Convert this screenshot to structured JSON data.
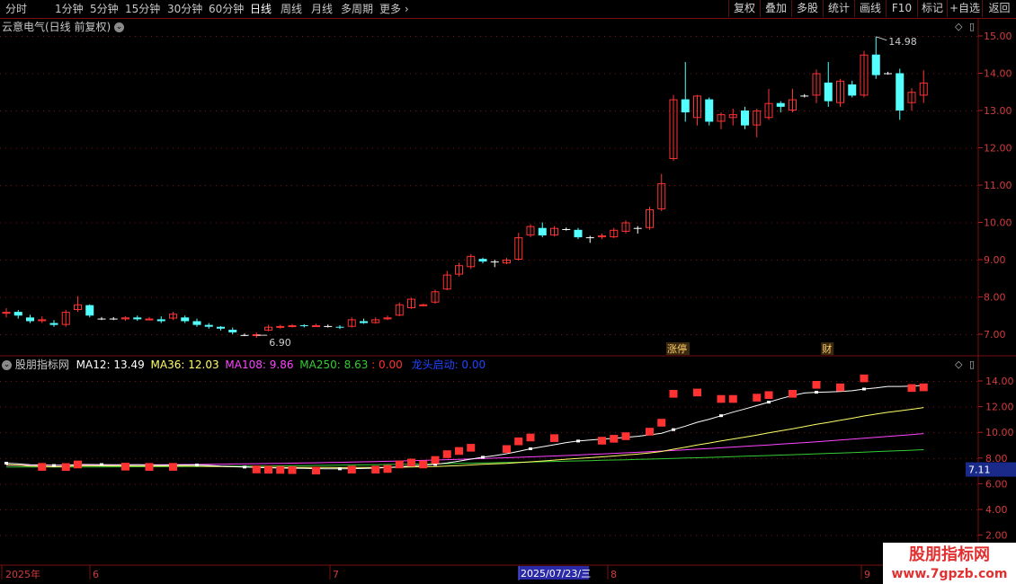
{
  "toolbar": {
    "periods": [
      "分时",
      "1分钟",
      "5分钟",
      "15分钟",
      "30分钟",
      "60分钟",
      "日线",
      "周线",
      "月线",
      "多周期",
      "更多"
    ],
    "active": "日线",
    "right_buttons": [
      "复权",
      "叠加",
      "多股",
      "统计",
      "画线",
      "F10",
      "标记",
      "+自选",
      "返回"
    ]
  },
  "main_header": {
    "title": "云意电气(日线 前复权)"
  },
  "price_axis": {
    "labels": [
      "15.00",
      "14.00",
      "13.00",
      "12.00",
      "11.00",
      "10.00",
      "9.00",
      "8.00",
      "7.00"
    ]
  },
  "high_label": "14.98",
  "low_label": "6.90",
  "event_tags": [
    "涨停",
    "财"
  ],
  "indicator_header": {
    "name": "股朋指标网",
    "ma12": "MA12: 13.49",
    "ma36": "MA36: 12.03",
    "ma108": "MA108: 9.86",
    "ma250": "MA250: 8.63",
    "val": ": 0.00",
    "longstart": "龙头启动: 0.00"
  },
  "indicator_axis": {
    "labels": [
      "14.00",
      "12.00",
      "10.00",
      "8.00",
      "6.00",
      "4.00",
      "2.00"
    ],
    "marker": "7.11"
  },
  "date_axis": {
    "labels": [
      "2025年",
      "6",
      "7",
      "8",
      "9"
    ],
    "cursor": "2025/07/23/三"
  },
  "watermark": {
    "line1": "股朋指标网",
    "line2": "www.7gpzb.com"
  },
  "colors": {
    "up": "#ff3232",
    "down": "#54ffff",
    "ma12": "#ffffff",
    "ma36": "#ffff66",
    "ma108": "#ff44ff",
    "ma250": "#33cc33",
    "grid": "#7a1010"
  },
  "chart_data": {
    "type": "candlestick",
    "y_range": [
      6.5,
      15.3
    ],
    "candles": [
      [
        7.55,
        7.6,
        7.7,
        7.45
      ],
      [
        7.6,
        7.5,
        7.65,
        7.42
      ],
      [
        7.45,
        7.35,
        7.52,
        7.3
      ],
      [
        7.35,
        7.4,
        7.48,
        7.3
      ],
      [
        7.3,
        7.25,
        7.38,
        7.2
      ],
      [
        7.25,
        7.6,
        7.65,
        7.2
      ],
      [
        7.65,
        7.8,
        8.02,
        7.6
      ],
      [
        7.78,
        7.5,
        7.8,
        7.45
      ],
      [
        7.42,
        7.42,
        7.46,
        7.38
      ],
      [
        7.42,
        7.42,
        7.46,
        7.38
      ],
      [
        7.4,
        7.45,
        7.48,
        7.36
      ],
      [
        7.45,
        7.4,
        7.5,
        7.36
      ],
      [
        7.4,
        7.42,
        7.46,
        7.38
      ],
      [
        7.4,
        7.35,
        7.48,
        7.3
      ],
      [
        7.42,
        7.55,
        7.6,
        7.38
      ],
      [
        7.45,
        7.35,
        7.5,
        7.3
      ],
      [
        7.35,
        7.25,
        7.42,
        7.2
      ],
      [
        7.25,
        7.2,
        7.3,
        7.15
      ],
      [
        7.2,
        7.15,
        7.22,
        7.1
      ],
      [
        7.12,
        7.05,
        7.18,
        7.0
      ],
      [
        6.98,
        6.98,
        7.02,
        6.95
      ],
      [
        6.98,
        7.0,
        7.05,
        6.9
      ],
      [
        7.1,
        7.2,
        7.25,
        7.08
      ],
      [
        7.18,
        7.22,
        7.25,
        7.15
      ],
      [
        7.2,
        7.24,
        7.27,
        7.18
      ],
      [
        7.24,
        7.22,
        7.27,
        7.18
      ],
      [
        7.22,
        7.24,
        7.28,
        7.2
      ],
      [
        7.22,
        7.22,
        7.26,
        7.18
      ],
      [
        7.2,
        7.18,
        7.24,
        7.14
      ],
      [
        7.2,
        7.4,
        7.45,
        7.18
      ],
      [
        7.35,
        7.3,
        7.42,
        7.28
      ],
      [
        7.3,
        7.4,
        7.45,
        7.28
      ],
      [
        7.4,
        7.45,
        7.5,
        7.38
      ],
      [
        7.5,
        7.8,
        7.85,
        7.48
      ],
      [
        7.7,
        7.95,
        7.98,
        7.68
      ],
      [
        7.78,
        7.8,
        7.82,
        7.75
      ],
      [
        7.85,
        8.15,
        8.2,
        7.82
      ],
      [
        8.2,
        8.6,
        8.7,
        8.18
      ],
      [
        8.6,
        8.85,
        8.92,
        8.55
      ],
      [
        8.8,
        9.1,
        9.15,
        8.75
      ],
      [
        9.02,
        8.95,
        9.05,
        8.9
      ],
      [
        8.95,
        8.95,
        9.0,
        8.8
      ],
      [
        8.9,
        9.0,
        9.05,
        8.88
      ],
      [
        9.0,
        9.6,
        9.72,
        8.98
      ],
      [
        9.65,
        9.9,
        9.95,
        9.6
      ],
      [
        9.85,
        9.65,
        10.0,
        9.6
      ],
      [
        9.65,
        9.85,
        9.9,
        9.62
      ],
      [
        9.82,
        9.82,
        9.86,
        9.78
      ],
      [
        9.8,
        9.6,
        9.85,
        9.55
      ],
      [
        9.6,
        9.6,
        9.64,
        9.45
      ],
      [
        9.6,
        9.65,
        9.7,
        9.55
      ],
      [
        9.6,
        9.8,
        9.85,
        9.58
      ],
      [
        9.75,
        10.0,
        10.05,
        9.7
      ],
      [
        9.85,
        9.85,
        9.9,
        9.7
      ],
      [
        9.85,
        10.35,
        10.42,
        9.8
      ],
      [
        10.35,
        11.05,
        11.3,
        10.3
      ],
      [
        11.7,
        13.3,
        13.42,
        11.65
      ],
      [
        13.3,
        12.95,
        14.3,
        12.7
      ],
      [
        12.8,
        13.4,
        13.42,
        12.6
      ],
      [
        13.3,
        12.7,
        13.35,
        12.6
      ],
      [
        12.7,
        12.9,
        12.95,
        12.5
      ],
      [
        12.8,
        12.9,
        13.05,
        12.6
      ],
      [
        13.0,
        12.6,
        13.1,
        12.5
      ],
      [
        12.6,
        13.0,
        13.05,
        12.28
      ],
      [
        12.8,
        13.2,
        13.58,
        12.75
      ],
      [
        13.2,
        13.1,
        13.25,
        12.95
      ],
      [
        13.0,
        13.3,
        13.58,
        12.95
      ],
      [
        13.4,
        13.4,
        13.44,
        13.35
      ],
      [
        13.4,
        14.0,
        14.1,
        13.2
      ],
      [
        13.75,
        13.25,
        14.3,
        13.1
      ],
      [
        13.2,
        13.8,
        13.85,
        13.1
      ],
      [
        13.7,
        13.4,
        13.8,
        13.35
      ],
      [
        13.4,
        14.5,
        14.6,
        13.35
      ],
      [
        14.5,
        13.95,
        14.98,
        13.85
      ],
      [
        14.0,
        14.0,
        14.04,
        13.96
      ],
      [
        14.0,
        13.0,
        14.12,
        12.75
      ],
      [
        13.2,
        13.5,
        13.6,
        13.0
      ],
      [
        13.4,
        13.75,
        14.08,
        13.2
      ]
    ]
  }
}
